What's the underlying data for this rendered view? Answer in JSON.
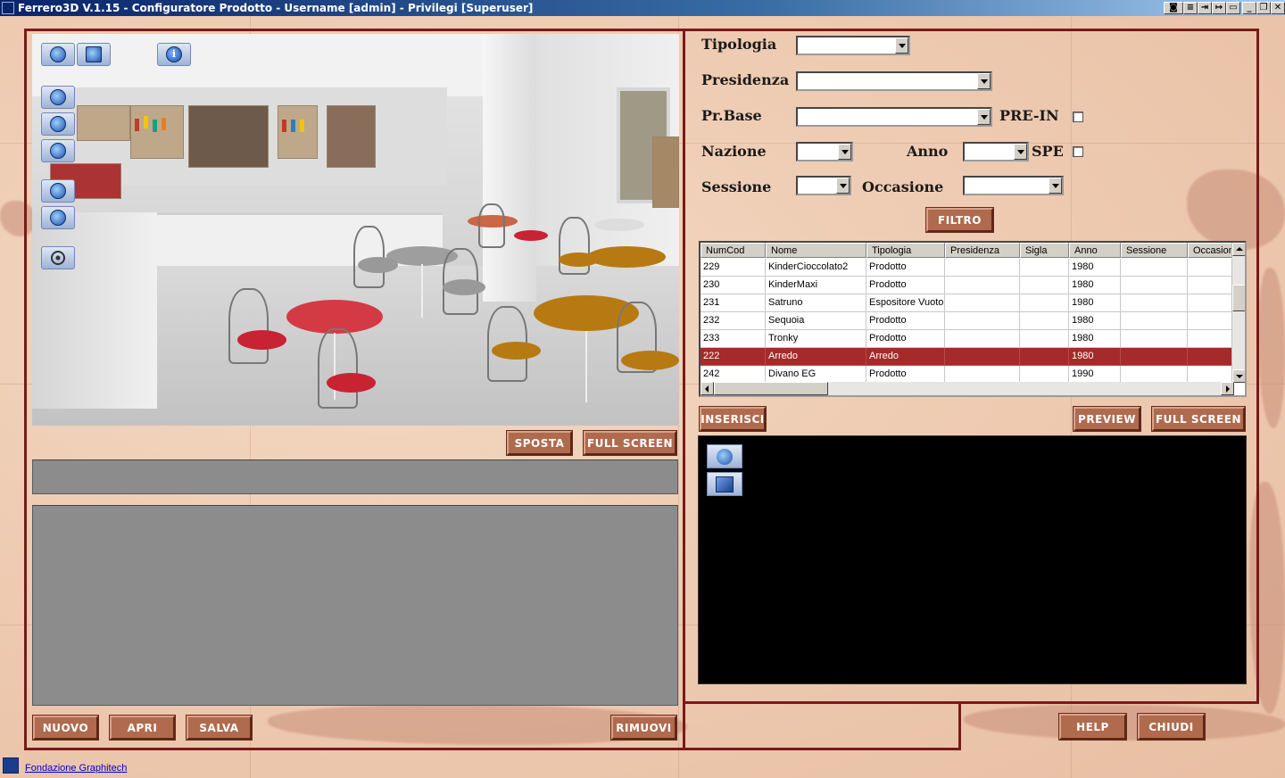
{
  "window": {
    "title": "Ferrero3D V.1.15 - Configuratore Prodotto - Username [admin] - Privilegi [Superuser]"
  },
  "left_panel": {
    "buttons": {
      "sposta": "SPOSTA",
      "full_screen": "FULL SCREEN",
      "nuovo": "NUOVO",
      "apri": "APRI",
      "salva": "SALVA",
      "rimuovi": "RIMUOVI"
    }
  },
  "filter": {
    "tipologia_label": "Tipologia",
    "presidenza_label": "Presidenza",
    "prbase_label": "Pr.Base",
    "prein_label": "PRE-IN",
    "nazione_label": "Nazione",
    "anno_label": "Anno",
    "spe_label": "SPE",
    "sessione_label": "Sessione",
    "occasione_label": "Occasione",
    "filtro_button": "FILTRO",
    "tipologia_value": "",
    "presidenza_value": "",
    "prbase_value": "",
    "nazione_value": "",
    "anno_value": "",
    "sessione_value": "",
    "occasione_value": "",
    "prein_checked": false,
    "spe_checked": false
  },
  "table": {
    "columns": [
      "NumCod",
      "Nome",
      "Tipologia",
      "Presidenza",
      "Sigla",
      "Anno",
      "Sessione",
      "Occasion"
    ],
    "rows": [
      [
        "229",
        "KinderCioccolato2",
        "Prodotto",
        "",
        "",
        "1980",
        "",
        ""
      ],
      [
        "230",
        "KinderMaxi",
        "Prodotto",
        "",
        "",
        "1980",
        "",
        ""
      ],
      [
        "231",
        "Satruno",
        "Espositore Vuoto",
        "",
        "",
        "1980",
        "",
        ""
      ],
      [
        "232",
        "Sequoia",
        "Prodotto",
        "",
        "",
        "1980",
        "",
        ""
      ],
      [
        "233",
        "Tronky",
        "Prodotto",
        "",
        "",
        "1980",
        "",
        ""
      ],
      [
        "222",
        "Arredo",
        "Arredo",
        "",
        "",
        "1980",
        "",
        ""
      ],
      [
        "242",
        "Divano EG",
        "Prodotto",
        "",
        "",
        "1990",
        "",
        ""
      ]
    ],
    "selected_row": 5
  },
  "right_panel": {
    "buttons": {
      "inserisci": "INSERISCI",
      "preview": "PREVIEW",
      "full_screen": "FULL SCREEN",
      "help": "HELP",
      "chiudi": "CHIUDI"
    }
  },
  "footer": {
    "link": "Fondazione Graphitech"
  },
  "colors": {
    "frame": "#7a1a1a",
    "button": "#b06a4e",
    "selected_row": "#a52a2a"
  }
}
